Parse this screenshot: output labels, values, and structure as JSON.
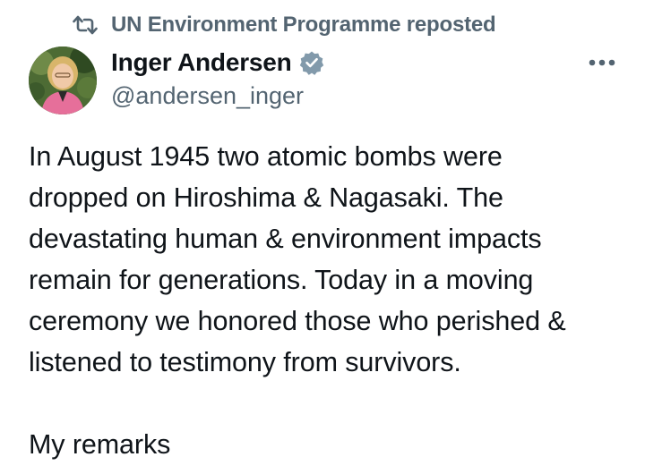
{
  "repost": {
    "icon": "repost-icon",
    "text": "UN Environment Programme reposted"
  },
  "author": {
    "display_name": "Inger Andersen",
    "handle": "@andersen_inger",
    "verified_icon": "verified-badge-icon",
    "avatar_icon": "profile-photo"
  },
  "more_icon": "more-options-icon",
  "tweet": {
    "lines": [
      "In August 1945 two atomic bombs were",
      "dropped on Hiroshima & Nagasaki. The",
      "devastating human & environment impacts",
      "remain for generations. Today in a moving",
      "ceremony we honored those who perished &",
      "listened to testimony from survivors."
    ],
    "remarks": "My remarks"
  },
  "colors": {
    "text": "#0f1419",
    "secondary": "#536471",
    "verified": "#829aab"
  }
}
